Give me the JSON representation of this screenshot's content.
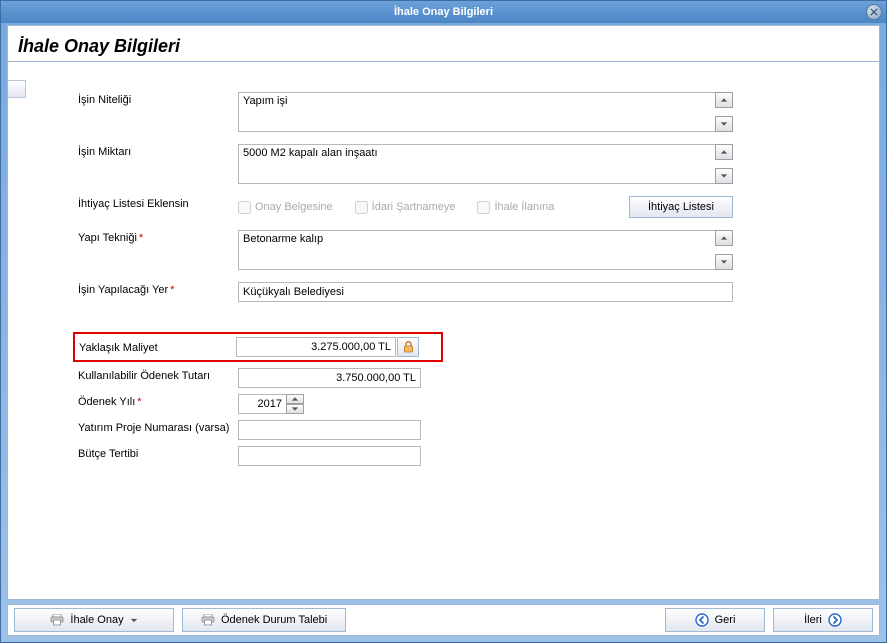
{
  "window": {
    "title": "İhale Onay Bilgileri"
  },
  "page": {
    "title": "İhale Onay Bilgileri"
  },
  "labels": {
    "isin_niteligi": "İşin Niteliği",
    "isin_miktari": "İşin Miktarı",
    "ihtiyac_listesi_eklensin": "İhtiyaç Listesi Eklensin",
    "yapi_teknigi": "Yapı Tekniği",
    "isin_yapilacagi_yer": "İşin Yapılacağı Yer",
    "yaklasik_maliyet": "Yaklaşık Maliyet",
    "kullanilabilir_odenek": "Kullanılabilir Ödenek Tutarı",
    "odenek_yili": "Ödenek Yılı",
    "yatirim_proje_no": "Yatırım Proje Numarası (varsa)",
    "butce_tertibi": "Bütçe Tertibi"
  },
  "checks": {
    "onay_belgesine": "Onay Belgesine",
    "idari_sartnameye": "İdari Şartnameye",
    "ihale_ilanina": "İhale İlanına"
  },
  "buttons": {
    "ihtiyac_listesi": "İhtiyaç Listesi",
    "ihale_onay": "İhale Onay",
    "odenek_durum_talebi": "Ödenek Durum Talebi",
    "geri": "Geri",
    "ileri": "İleri"
  },
  "values": {
    "isin_niteligi": "Yapım işi",
    "isin_miktari": "5000 M2 kapalı alan inşaatı",
    "yapi_teknigi": "Betonarme kalıp",
    "isin_yapilacagi_yer": "Küçükyalı Belediyesi",
    "yaklasik_maliyet": "3.275.000,00 TL",
    "kullanilabilir_odenek": "3.750.000,00 TL",
    "odenek_yili": "2017",
    "yatirim_proje_no": "",
    "butce_tertibi": ""
  }
}
